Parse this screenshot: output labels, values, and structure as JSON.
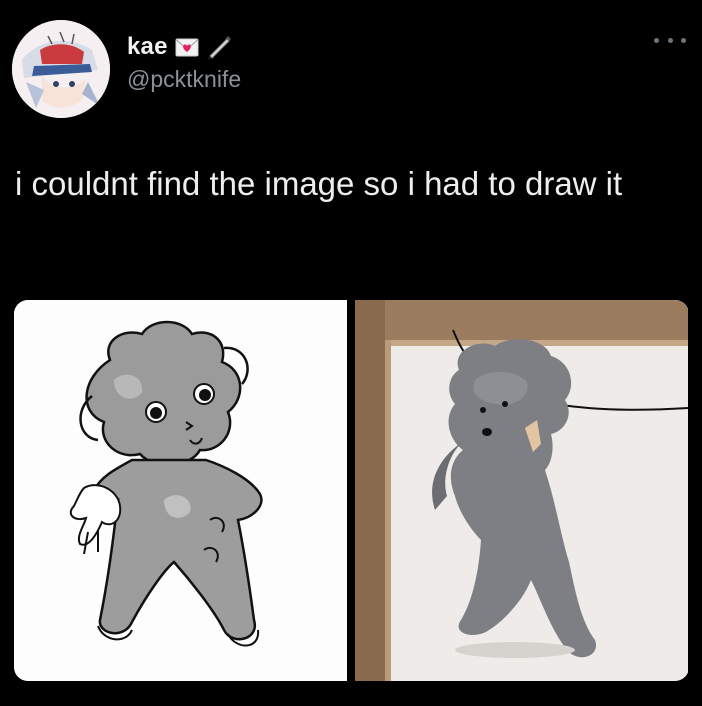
{
  "tweet": {
    "author": {
      "display_name": "kae",
      "handle": "@pcktknife",
      "name_emojis": [
        "love-letter-icon",
        "pen-icon"
      ]
    },
    "more_icon": "more-horizontal-icon",
    "text": "i couldnt find the image so i had to draw it",
    "media": [
      {
        "kind": "drawing",
        "icon": "drawn-dog-image"
      },
      {
        "kind": "photo",
        "icon": "poodle-photo-image"
      }
    ]
  },
  "colors": {
    "background": "#000000",
    "text": "#e7e9ea",
    "secondary_text": "#8b9199"
  }
}
